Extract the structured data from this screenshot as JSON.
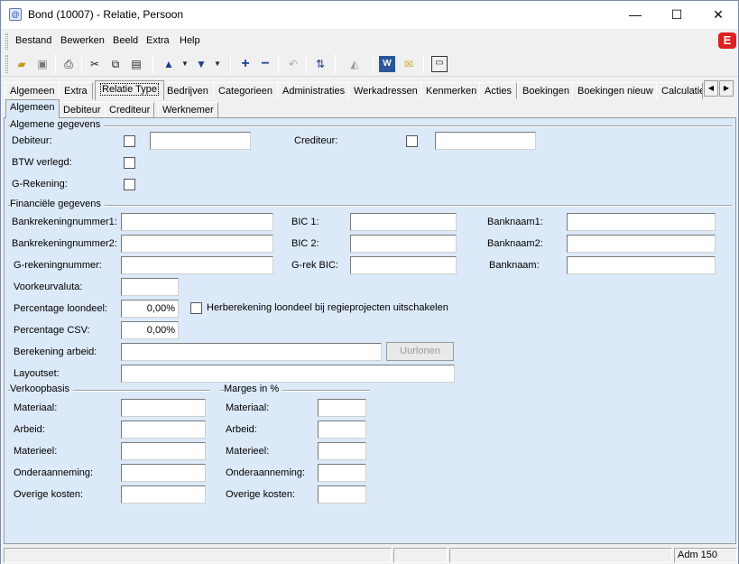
{
  "window": {
    "title": "Bond (10007) - Relatie, Persoon",
    "minimize": "—",
    "maximize": "☐",
    "close": "✕"
  },
  "menu": [
    {
      "label": "Bestand"
    },
    {
      "label": "Bewerken"
    },
    {
      "label": "Beeld"
    },
    {
      "label": "Extra"
    },
    {
      "label": "Help"
    }
  ],
  "brand_logo": "E",
  "toolbar_icons": [
    "open-folder-icon",
    "save-icon",
    "print-icon",
    "cut-icon",
    "copy-icon",
    "paste-icon",
    "arrow-up-icon",
    "arrow-down-icon",
    "add-icon",
    "remove-icon",
    "undo-icon",
    "refresh-icon",
    "document-icon",
    "word-icon",
    "mail-icon",
    "window-icon"
  ],
  "tabs": [
    {
      "label": "Algemeen"
    },
    {
      "label": "Extra"
    },
    {
      "label": "Relatie Type"
    },
    {
      "label": "Bedrijven"
    },
    {
      "label": "Categorieen"
    },
    {
      "label": "Administraties"
    },
    {
      "label": "Werkadressen"
    },
    {
      "label": "Kenmerken"
    },
    {
      "label": "Acties"
    },
    {
      "label": "Boekingen"
    },
    {
      "label": "Boekingen nieuw"
    },
    {
      "label": "Calculaties"
    }
  ],
  "subtabs": [
    {
      "label": "Algemeen"
    },
    {
      "label": "Debiteur"
    },
    {
      "label": "Crediteur"
    },
    {
      "label": "Werknemer"
    }
  ],
  "general": {
    "group": "Algemene gegevens",
    "debiteur_label": "Debiteur:",
    "debiteur_value": "",
    "crediteur_label": "Crediteur:",
    "crediteur_value": "",
    "btw_label": "BTW verlegd:",
    "grek_label": "G-Rekening:"
  },
  "financial": {
    "group": "Financiële gegevens",
    "bank1_label": "Bankrekeningnummer1:",
    "bank1_value": "",
    "bank2_label": "Bankrekeningnummer2:",
    "bank2_value": "",
    "grek_label": "G-rekeningnummer:",
    "grek_value": "",
    "bic1_label": "BIC 1:",
    "bic1_value": "",
    "bic2_label": "BIC 2:",
    "bic2_value": "",
    "grekbic_label": "G-rek BIC:",
    "grekbic_value": "",
    "banknaam1_label": "Banknaam1:",
    "banknaam1_value": "",
    "banknaam2_label": "Banknaam2:",
    "banknaam2_value": "",
    "banknaam_label": "Banknaam:",
    "banknaam_value": "",
    "valuta_label": "Voorkeurvaluta:",
    "valuta_value": "",
    "loondeel_label": "Percentage loondeel:",
    "loondeel_value": "0,00%",
    "herberekening_label": "Herberekening loondeel bij regieprojecten uitschakelen",
    "csv_label": "Percentage CSV:",
    "csv_value": "0,00%",
    "arbeid_label": "Berekening arbeid:",
    "arbeid_value": "",
    "uurlonen_button": "Uurlonen",
    "layoutset_label": "Layoutset:",
    "layoutset_value": ""
  },
  "verkoopbasis": {
    "group": "Verkoopbasis",
    "rows": [
      {
        "label": "Materiaal:",
        "value": ""
      },
      {
        "label": "Arbeid:",
        "value": ""
      },
      {
        "label": "Materieel:",
        "value": ""
      },
      {
        "label": "Onderaanneming:",
        "value": ""
      },
      {
        "label": "Overige kosten:",
        "value": ""
      }
    ]
  },
  "marges": {
    "group": "Marges in %",
    "rows": [
      {
        "label": "Materiaal:",
        "value": ""
      },
      {
        "label": "Arbeid:",
        "value": ""
      },
      {
        "label": "Materieel:",
        "value": ""
      },
      {
        "label": "Onderaanneming:",
        "value": ""
      },
      {
        "label": "Overige kosten:",
        "value": ""
      }
    ]
  },
  "status": {
    "user": "Adm 150"
  },
  "colors": {
    "panel": "#dce9f8",
    "logo": "#e02020"
  }
}
